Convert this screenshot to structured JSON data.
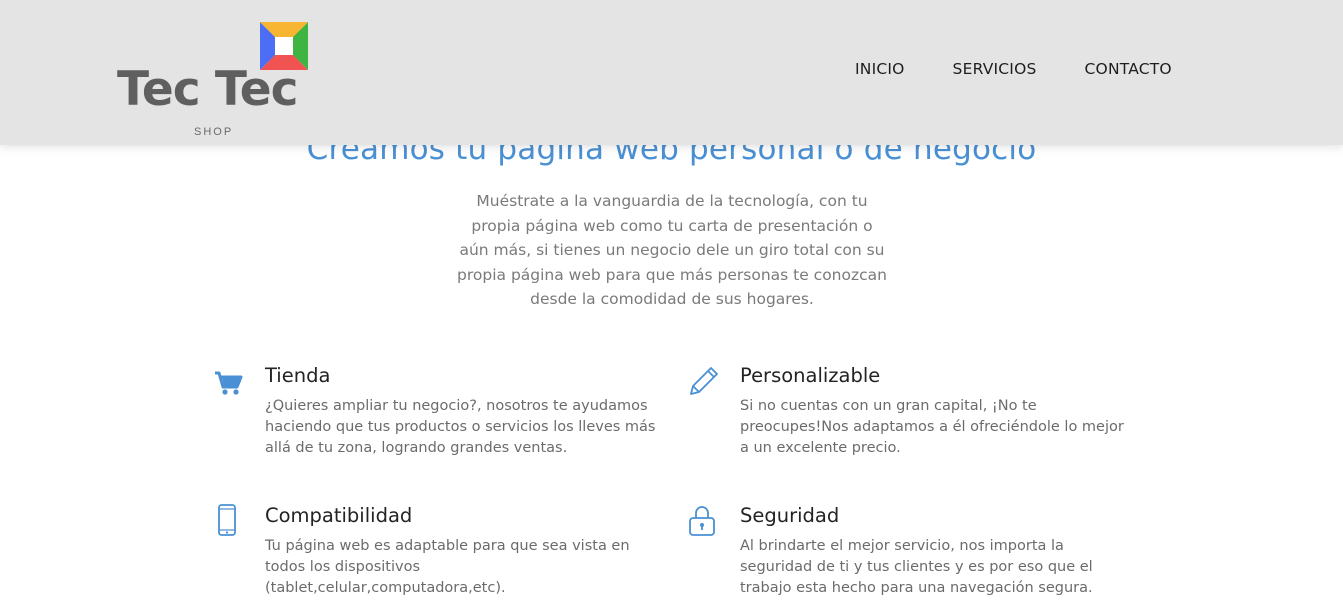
{
  "brand": {
    "name": "Tec Tec",
    "tagline": "SHOP",
    "logo_colors": [
      "#f7b531",
      "#3fb443",
      "#f15353",
      "#4c6ef5"
    ]
  },
  "nav": {
    "items": [
      {
        "label": "INICIO"
      },
      {
        "label": "SERVICIOS"
      },
      {
        "label": "CONTACTO"
      }
    ]
  },
  "hero": {
    "title": "Creamos tu página web personal o de negocio",
    "description": "Muéstrate a la vanguardia de la tecnología, con tu propia página web como tu carta de presentación o aún más, si tienes un negocio dele un giro total con su propia página web para que más personas te conozcan desde la comodidad de sus hogares."
  },
  "features": [
    {
      "icon": "cart-icon",
      "title": "Tienda",
      "description": "¿Quieres ampliar tu negocio?, nosotros te ayudamos haciendo que tus productos o servicios los lleves más allá de tu zona, logrando grandes ventas."
    },
    {
      "icon": "pencil-icon",
      "title": "Personalizable",
      "description": "Si no cuentas con un gran capital, ¡No te preocupes!Nos adaptamos a él ofreciéndole lo mejor a un excelente precio."
    },
    {
      "icon": "mobile-phone-icon",
      "title": "Compatibilidad",
      "description": "Tu página web es adaptable para que sea vista en todos los dispositivos (tablet,celular,computadora,etc)."
    },
    {
      "icon": "lock-icon",
      "title": "Seguridad",
      "description": "Al brindarte el mejor servicio, nos importa la seguridad de ti y tus clientes y es por eso que el trabajo esta hecho para una navegación segura."
    }
  ],
  "colors": {
    "accent": "#4a90d4",
    "header_bg": "#e4e4e4",
    "text": "#6b6b6b"
  }
}
